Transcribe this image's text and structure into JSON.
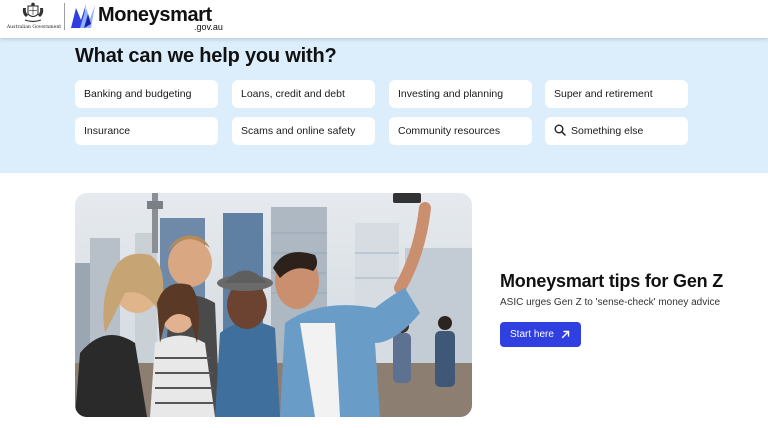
{
  "header": {
    "gov_label": "Australian Government",
    "brand_name": "Moneysmart",
    "brand_domain": ".gov.au"
  },
  "help": {
    "title": "What can we help you with?",
    "chips": [
      "Banking and budgeting",
      "Loans, credit and debt",
      "Investing and planning",
      "Super and retirement",
      "Insurance",
      "Scams and online safety",
      "Community resources",
      "Something else"
    ]
  },
  "feature": {
    "title": "Moneysmart tips for Gen Z",
    "subtitle": "ASIC urges Gen Z to 'sense-check' money advice",
    "button_label": "Start here"
  },
  "colors": {
    "accent": "#2f3fe0",
    "band_background": "#dcedfb",
    "brand_blue": "#2f3fe0"
  },
  "icons": [
    "coat-of-arms-icon",
    "moneysmart-logo-icon",
    "search-icon",
    "arrow-up-right-icon"
  ]
}
